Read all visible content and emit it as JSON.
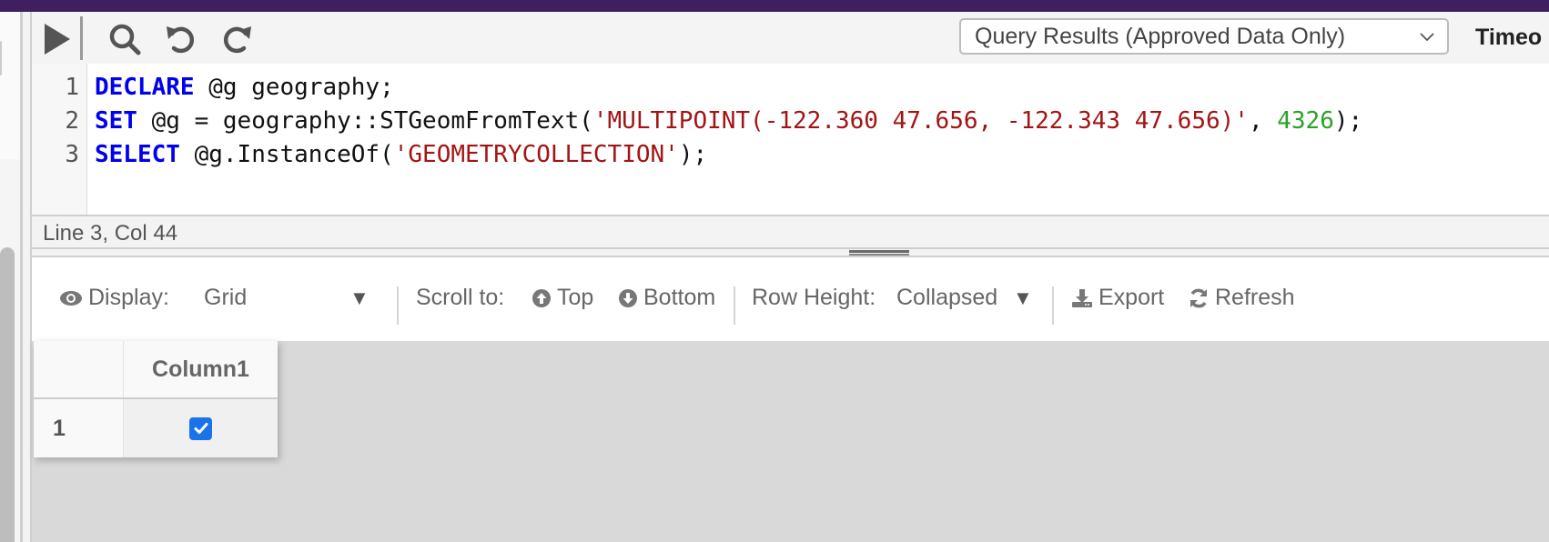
{
  "colors": {
    "topbar": "#3f1f5f",
    "keyword": "#0000ee",
    "string": "#a31515",
    "number": "#2aa22a",
    "checkbox": "#1a73e8"
  },
  "toolbar": {
    "icons": [
      "run-icon",
      "search-icon",
      "undo-icon",
      "redo-icon"
    ],
    "results_select": {
      "selected": "Query Results (Approved Data Only)"
    },
    "timeout_label": "Timeo"
  },
  "editor": {
    "lines": [
      {
        "number": "1",
        "tokens": [
          {
            "type": "kw",
            "text": "DECLARE"
          },
          {
            "type": "plain",
            "text": " @g geography;"
          }
        ]
      },
      {
        "number": "2",
        "tokens": [
          {
            "type": "kw",
            "text": "SET"
          },
          {
            "type": "plain",
            "text": " @g = geography::STGeomFromText("
          },
          {
            "type": "str",
            "text": "'MULTIPOINT(-122.360 47.656, -122.343 47.656)'"
          },
          {
            "type": "plain",
            "text": ", "
          },
          {
            "type": "num",
            "text": "4326"
          },
          {
            "type": "plain",
            "text": ");"
          }
        ]
      },
      {
        "number": "3",
        "tokens": [
          {
            "type": "kw",
            "text": "SELECT"
          },
          {
            "type": "plain",
            "text": " @g.InstanceOf("
          },
          {
            "type": "str",
            "text": "'GEOMETRYCOLLECTION'"
          },
          {
            "type": "plain",
            "text": ");"
          }
        ]
      }
    ],
    "status": "Line 3, Col 44"
  },
  "results_toolbar": {
    "display_label": "Display:",
    "display_value": "Grid",
    "scroll_label": "Scroll to:",
    "top_label": "Top",
    "bottom_label": "Bottom",
    "row_height_label": "Row Height:",
    "row_height_value": "Collapsed",
    "export_label": "Export",
    "refresh_label": "Refresh"
  },
  "grid": {
    "columns": [
      "Column1"
    ],
    "rows": [
      {
        "row_number": "1",
        "values": [
          true
        ]
      }
    ]
  }
}
